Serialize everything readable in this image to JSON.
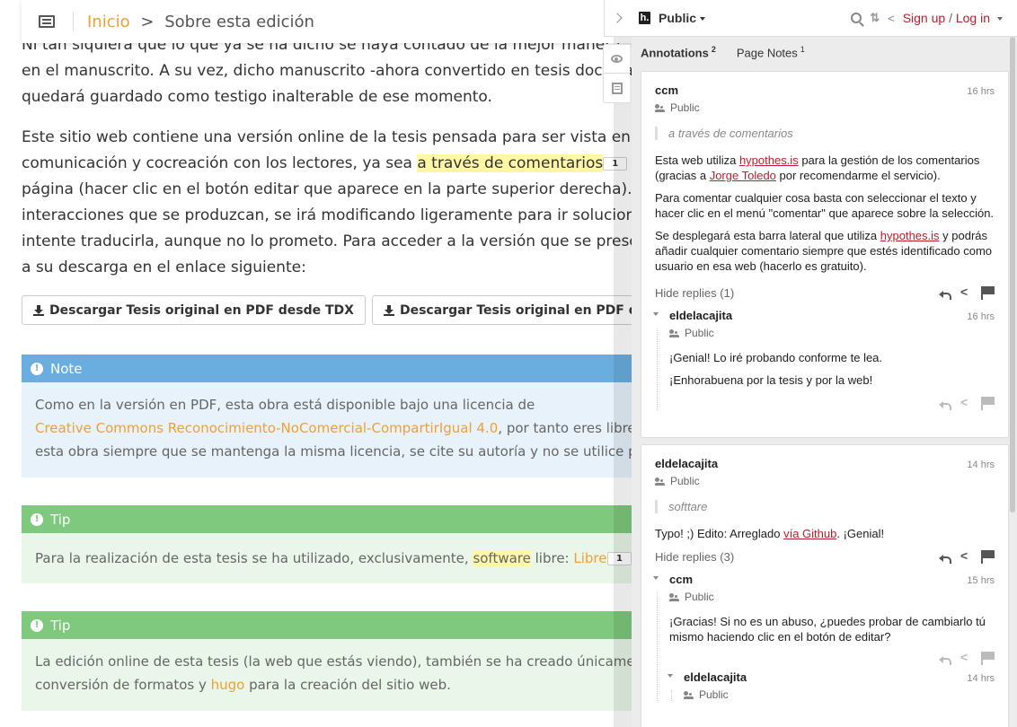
{
  "breadcrumb": {
    "home": "Inicio",
    "separator": ">",
    "current": "Sobre esta edición"
  },
  "content": {
    "p1_lines": [
      "Ni tan siquiera que lo que ya se ha dicho se haya contado de la mejor manera",
      "en el manuscrito. A su vez, dicho manuscrito -ahora convertido en tesis doctoral-",
      "quedará guardado como testigo inalterable de ese momento."
    ],
    "p2_line1": "Este sitio web contiene una versión online de la tesis pensada para ser vista en",
    "p2_line2_pre": "comunicación y cocreación con los lectores, ya sea ",
    "p2_line2_hl": "a través de comentarios",
    "p2_badge": "1",
    "p2_rest": [
      "página (hacer clic en el botón editar que aparece en la parte superior derecha).",
      "interacciones que se produzcan, se irá modificando ligeramente para ir solucionando",
      "intente traducirla, aunque no lo prometo. Para acceder a la versión que se presentó",
      "a su descarga en el enlace siguiente:"
    ]
  },
  "buttons": {
    "tdx": "Descargar Tesis original en PDF desde TDX",
    "zenodo": "Descargar Tesis original en PDF desde Zenodo"
  },
  "note_box": {
    "title": "Note",
    "line1": "Como en la versión en PDF, esta obra está disponible bajo una licencia de",
    "line2_link": "Creative Commons Reconocimiento-NoComercial-CompartirIgual 4.0",
    "line2_rest": ", por tanto eres libre de copiar",
    "line3": "esta obra siempre que se mantenga la misma licencia, se cite su autoría y no se utilice para fines"
  },
  "tip1": {
    "title": "Tip",
    "pre": "Para la realización de esta tesis se ha utilizado, exclusivamente, ",
    "hl": "software",
    "mid": " libre: ",
    "link": "LibreOffice",
    "badge": "1"
  },
  "tip2": {
    "title": "Tip",
    "line1": "La edición online de esta tesis (la web que estás viendo), también se ha creado únicamente",
    "line2_pre": "conversión de formatos y ",
    "line2_link": "hugo",
    "line2_post": " para la creación del sitio web."
  },
  "sidebar": {
    "scope": "Public",
    "signup": "Sign up",
    "slash": "/",
    "login": "Log in",
    "tabs": [
      {
        "label": "Annotations",
        "count": "2"
      },
      {
        "label": "Page Notes",
        "count": "1"
      }
    ],
    "card1": {
      "user": "ccm",
      "time": "16 hrs",
      "visibility": "Public",
      "quote": "a través de comentarios",
      "p1_a": "Esta web utiliza ",
      "p1_link1": "hypothes.is",
      "p1_b": " para la gestión de los comentarios (gracias a ",
      "p1_link2": "Jorge Toledo",
      "p1_c": " por recomendarme el servicio).",
      "p2": "Para comentar cualquier cosa basta con seleccionar el texto y hacer clic en el menú \"comentar\" que aparece sobre la selección.",
      "p3_a": "Se desplegará esta barra lateral que utiliza ",
      "p3_link": "hypothes.is",
      "p3_b": " y podrás añadir cualquier comentario siempre que estés identificado como usuario en esa web (hacerlo es gratuito).",
      "hide_replies": "Hide replies (1)",
      "reply": {
        "user": "eldelacajita",
        "time": "16 hrs",
        "visibility": "Public",
        "p1": "¡Genial! Lo iré probando conforme te lea.",
        "p2": "¡Enhorabuena por la tesis y por la web!"
      }
    },
    "card2": {
      "user": "eldelacajita",
      "time": "14 hrs",
      "visibility": "Public",
      "quote": "softtare",
      "text_a": "Typo! ;) Edito: Arreglado ",
      "text_link": "vía Github",
      "text_b": ". ¡Genial!",
      "hide_replies": "Hide replies (3)",
      "reply1": {
        "user": "ccm",
        "time": "15 hrs",
        "visibility": "Public",
        "text": "¡Gracias! Si no es un abuso, ¿puedes probar de cambiarlo tú mismo haciendo clic en el botón de editar?"
      },
      "reply2": {
        "user": "eldelacajita",
        "time": "14 hrs",
        "visibility": "Public"
      }
    }
  }
}
